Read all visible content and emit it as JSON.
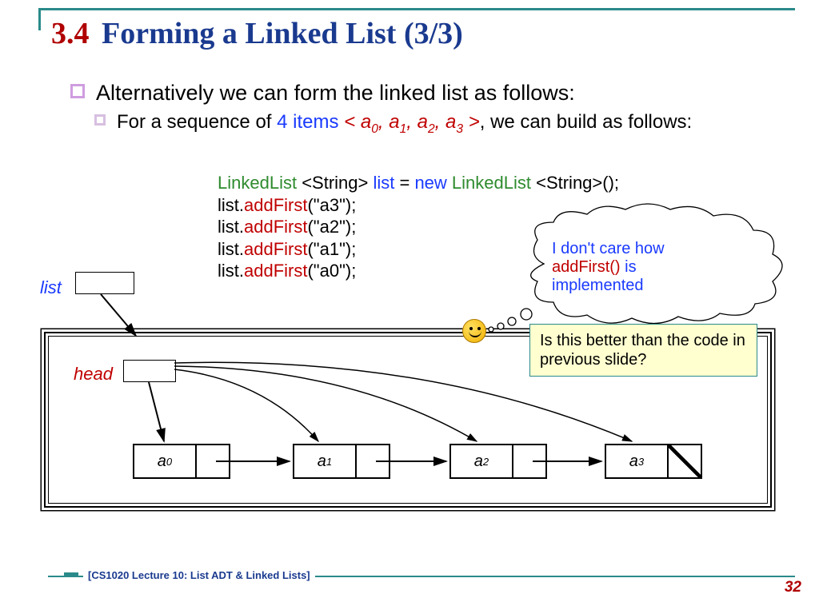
{
  "title": {
    "number": "3.4",
    "text": "Forming a Linked List (3/3)"
  },
  "bullet1": "Alternatively we can form the linked list as follows:",
  "bullet2": {
    "prefix": "For a sequence of ",
    "items_count": "4 items",
    "seq_open": " < ",
    "seq": [
      "a",
      "a",
      "a",
      "a"
    ],
    "seq_subs": [
      "0",
      "1",
      "2",
      "3"
    ],
    "seq_close": " >",
    "suffix": ", we can build as follows:"
  },
  "code": {
    "decl": {
      "type1": "LinkedList",
      "gen": " <String> ",
      "var": "list",
      "eq": " = ",
      "kw": "new",
      "type2": " LinkedList",
      "gen2": " <String>",
      "paren": "();"
    },
    "calls": [
      {
        "obj": "list.",
        "method": "addFirst",
        "arg": "(\"a3\");"
      },
      {
        "obj": "list.",
        "method": "addFirst",
        "arg": "(\"a2\");"
      },
      {
        "obj": "list.",
        "method": "addFirst",
        "arg": "(\"a1\");"
      },
      {
        "obj": "list.",
        "method": "addFirst",
        "arg": "(\"a0\");"
      }
    ]
  },
  "labels": {
    "list": "list",
    "head": "head"
  },
  "nodes": [
    {
      "name": "a",
      "sub": "0"
    },
    {
      "name": "a",
      "sub": "1"
    },
    {
      "name": "a",
      "sub": "2"
    },
    {
      "name": "a",
      "sub": "3"
    }
  ],
  "thought": {
    "l1": "I don't care how",
    "method": "addFirst()",
    "l2": " is",
    "l3": "implemented"
  },
  "question": "Is this better than the code in previous slide?",
  "footer": "[CS1020 Lecture 10: List ADT & Linked Lists]",
  "page": "32"
}
